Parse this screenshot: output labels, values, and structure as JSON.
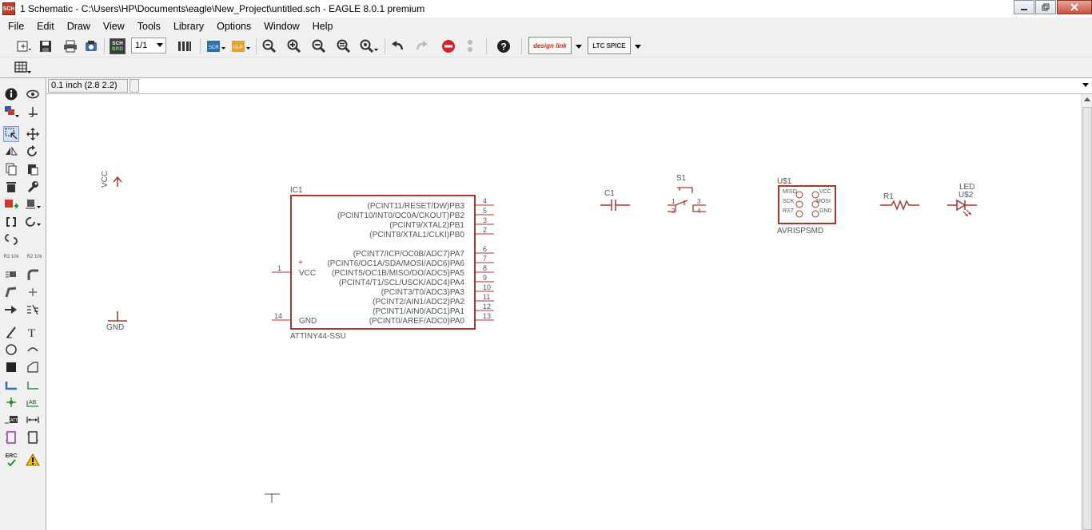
{
  "window": {
    "title": "1 Schematic - C:\\Users\\HP\\Documents\\eagle\\New_Project\\untitled.sch - EAGLE 8.0.1 premium",
    "app_icon": "SCH"
  },
  "menu": [
    "File",
    "Edit",
    "Draw",
    "View",
    "Tools",
    "Library",
    "Options",
    "Window",
    "Help"
  ],
  "toolbar": {
    "sheet_select": "1/1",
    "sch_brd_label": [
      "SCH",
      "BRD"
    ],
    "designlink_label": "design link",
    "ltspice_label": "LTC SPICE"
  },
  "command_row": {
    "coordinates": "0.1 inch (2.8 2.2)"
  },
  "palette": {
    "value_label_a": "R2 10k",
    "value_label_b": "R2 10k",
    "erc_label": "ERC"
  },
  "schematic": {
    "vcc_label": "VCC",
    "gnd_label": "GND",
    "ic1": {
      "name": "IC1",
      "value": "ATTINY44-SSU",
      "left_pins": [
        {
          "num": "1",
          "name": "VCC"
        },
        {
          "num": "14",
          "name": "GND"
        }
      ],
      "right_pins": [
        {
          "num": "4",
          "name": "(PCINT11/RESET/DW)PB3"
        },
        {
          "num": "5",
          "name": "(PCINT10/INT0/OC0A/CKOUT)PB2"
        },
        {
          "num": "3",
          "name": "(PCINT9/XTAL2)PB1"
        },
        {
          "num": "2",
          "name": "(PCINT8/XTAL1/CLKI)PB0"
        },
        {
          "num": "6",
          "name": "(PCINT7/ICP/OC0B/ADC7)PA7"
        },
        {
          "num": "7",
          "name": "(PCINT6/OC1A/SDA/MOSI/ADC6)PA6"
        },
        {
          "num": "8",
          "name": "(PCINT5/OC1B/MISO/DO/ADC5)PA5"
        },
        {
          "num": "9",
          "name": "(PCINT4/T1/SCL/USCK/ADC4)PA4"
        },
        {
          "num": "10",
          "name": "(PCINT3/T0/ADC3)PA3"
        },
        {
          "num": "11",
          "name": "(PCINT2/AIN1/ADC2)PA2"
        },
        {
          "num": "12",
          "name": "(PCINT1/AIN0/ADC1)PA1"
        },
        {
          "num": "13",
          "name": "(PCINT0/AREF/ADC0)PA0"
        }
      ]
    },
    "c1": {
      "name": "C1"
    },
    "s1": {
      "name": "S1",
      "pins": [
        "1",
        "2",
        "3",
        "4"
      ]
    },
    "u1": {
      "name": "U$1",
      "value": "AVRISPSMD",
      "left_pins": [
        "MISO",
        "SCK",
        "RST"
      ],
      "right_pins": [
        "VCC",
        "MOSI",
        "GND"
      ]
    },
    "r1": {
      "name": "R1"
    },
    "led": {
      "value": "LED",
      "name": "U$2"
    }
  },
  "colors": {
    "schematic_symbol": "#a33a32",
    "schematic_text": "#555555",
    "canvas_background": "#ffffff"
  }
}
